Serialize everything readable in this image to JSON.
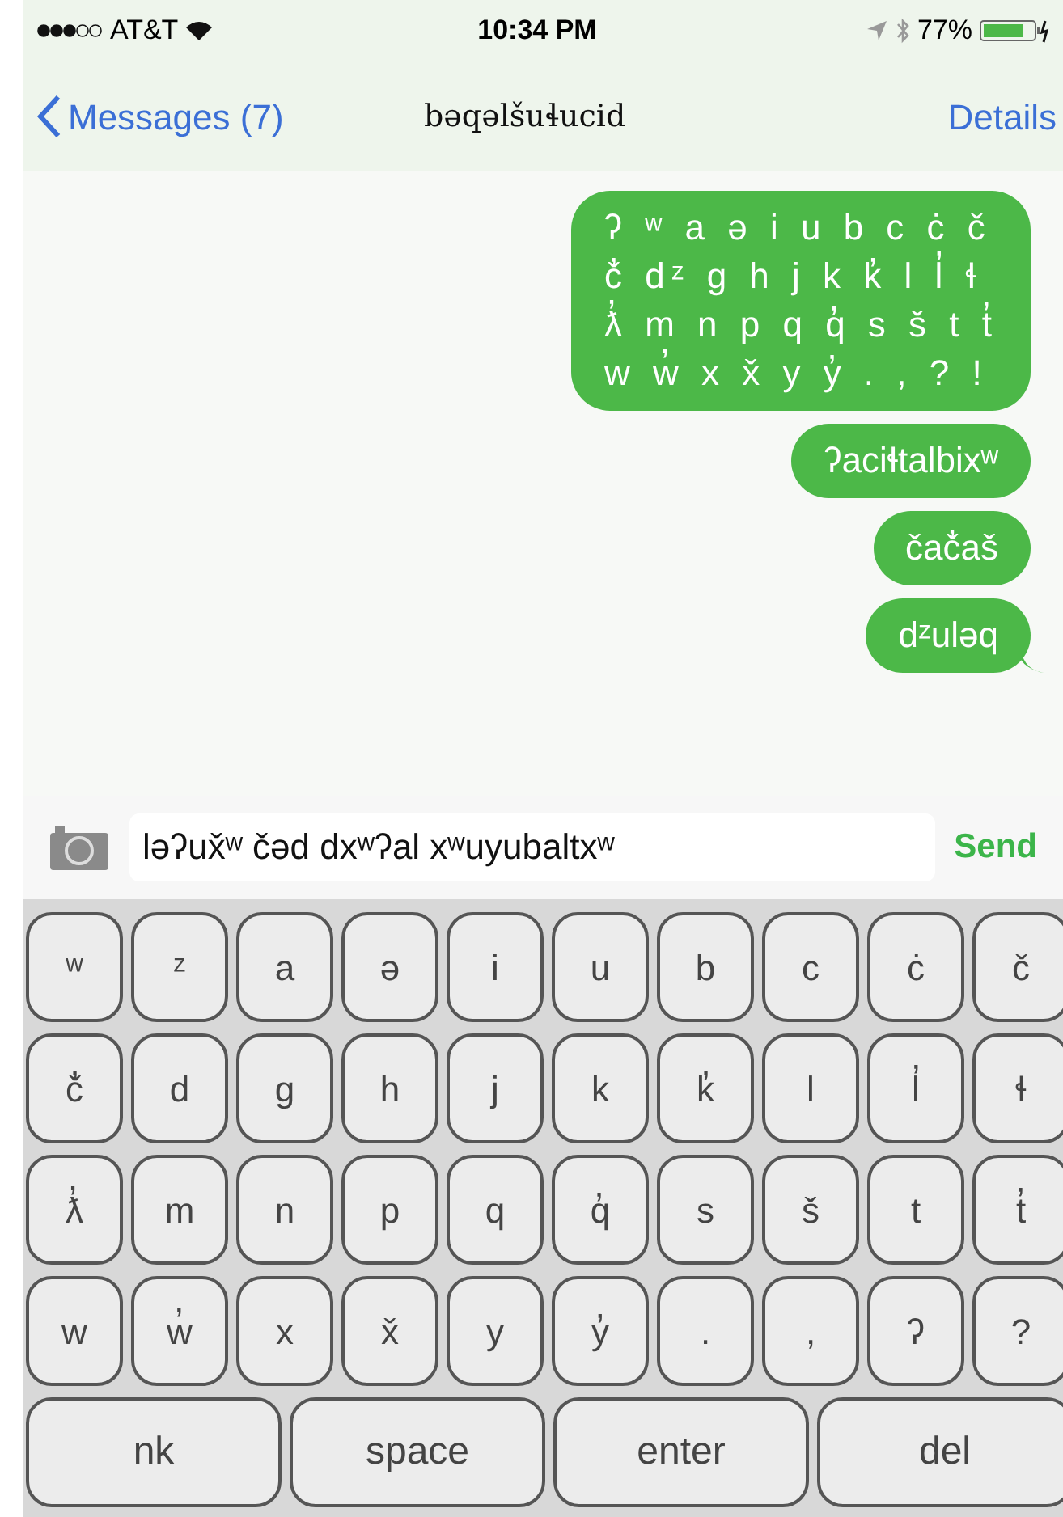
{
  "status_bar": {
    "carrier": "AT&T",
    "time": "10:34 PM",
    "battery": "77%"
  },
  "nav": {
    "back": "Messages (7)",
    "title": "bəqəlšuɬucid",
    "action": "Details"
  },
  "messages": [
    {
      "lines": [
        "ʔ ʷ a ə i u b c ċ č",
        "č̓ dᶻ g h j k k̓ l l̓ ɬ",
        "ƛ̓ m n p q q̓ s š t t̓",
        "w w̓ x x̌ y y̓ . , ? !"
      ],
      "tail": false
    },
    {
      "lines": [
        "ʔaciɬtalbixʷ"
      ],
      "tail": false
    },
    {
      "lines": [
        "čač̓aš"
      ],
      "tail": false
    },
    {
      "lines": [
        "dᶻuləq"
      ],
      "tail": true
    }
  ],
  "composer": {
    "value": "ləʔux̌ʷ čəd dxʷʔal xʷuyubaltxʷ",
    "send": "Send"
  },
  "keyboard": {
    "rows": [
      [
        "ʷ",
        "ᶻ",
        "a",
        "ə",
        "i",
        "u",
        "b",
        "c",
        "ċ",
        "č"
      ],
      [
        "č̓",
        "d",
        "g",
        "h",
        "j",
        "k",
        "k̓",
        "l",
        "l̓",
        "ɬ"
      ],
      [
        "ƛ̓",
        "m",
        "n",
        "p",
        "q",
        "q̓",
        "s",
        "š",
        "t",
        "t̓"
      ],
      [
        "w",
        "w̓",
        "x",
        "x̌",
        "y",
        "y̓",
        ".",
        ",",
        "ʔ",
        "?"
      ]
    ],
    "bottom_row": [
      "nk",
      "space",
      "enter",
      "del"
    ]
  }
}
